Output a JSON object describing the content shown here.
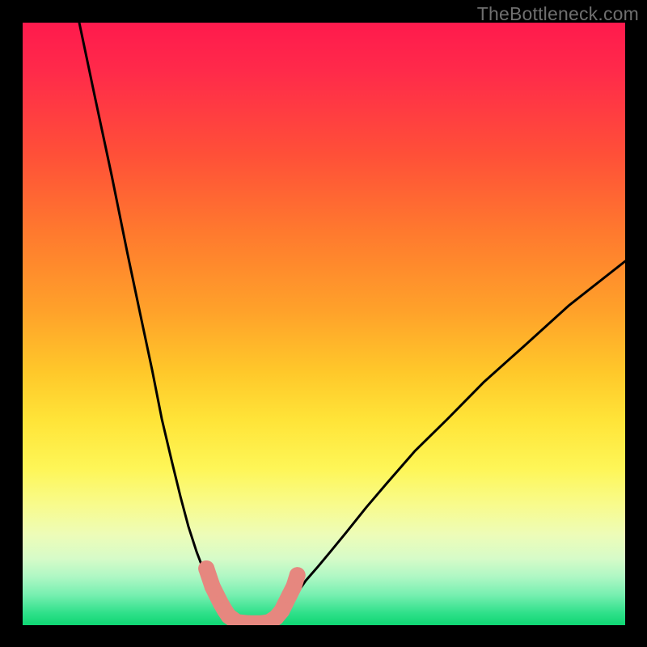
{
  "watermark": "TheBottleneck.com",
  "chart_data": {
    "type": "line",
    "title": "",
    "xlabel": "",
    "ylabel": "",
    "xlim": [
      0,
      100
    ],
    "ylim": [
      0,
      100
    ],
    "grid": false,
    "legend": false,
    "series": [
      {
        "name": "left-curve",
        "x": [
          9.4,
          12.1,
          14.8,
          17.4,
          19.5,
          21.5,
          23.1,
          24.8,
          26.2,
          27.5,
          28.9,
          30.2,
          31.5,
          32.9,
          33.6,
          34.2,
          35.0
        ],
        "values": [
          100,
          87.2,
          74.5,
          61.7,
          51.7,
          42.3,
          34.2,
          27.0,
          21.3,
          16.4,
          12.1,
          8.7,
          5.9,
          3.6,
          2.4,
          1.5,
          0.5
        ]
      },
      {
        "name": "right-curve",
        "x": [
          41.6,
          42.3,
          43.0,
          44.3,
          45.6,
          47.0,
          49.0,
          51.0,
          53.7,
          57.0,
          60.4,
          65.1,
          70.5,
          76.5,
          83.2,
          90.6,
          100.0
        ],
        "values": [
          0.5,
          1.5,
          2.4,
          3.8,
          5.4,
          7.4,
          9.7,
          12.1,
          15.4,
          19.5,
          23.5,
          28.9,
          34.2,
          40.3,
          46.3,
          53.0,
          60.4
        ]
      },
      {
        "name": "bottom-marker-segment",
        "x": [
          30.5,
          31.5,
          32.2,
          32.9,
          33.6,
          34.2,
          35.6,
          37.6,
          39.6,
          40.9,
          42.1,
          43.0,
          43.6,
          44.3,
          45.0,
          45.6
        ],
        "values": [
          9.4,
          6.4,
          5.0,
          3.6,
          2.4,
          1.5,
          0.5,
          0.3,
          0.3,
          0.5,
          1.3,
          2.4,
          3.6,
          5.0,
          6.4,
          8.3
        ]
      }
    ],
    "marker_style": {
      "series": "bottom-marker-segment",
      "color": "#e6877f",
      "size": 10
    },
    "gradient_colors": {
      "top": "#ff1a4d",
      "upper_mid": "#ffa22a",
      "mid": "#fef657",
      "lower_mid": "#aef7c4",
      "bottom": "#0fd673"
    }
  }
}
